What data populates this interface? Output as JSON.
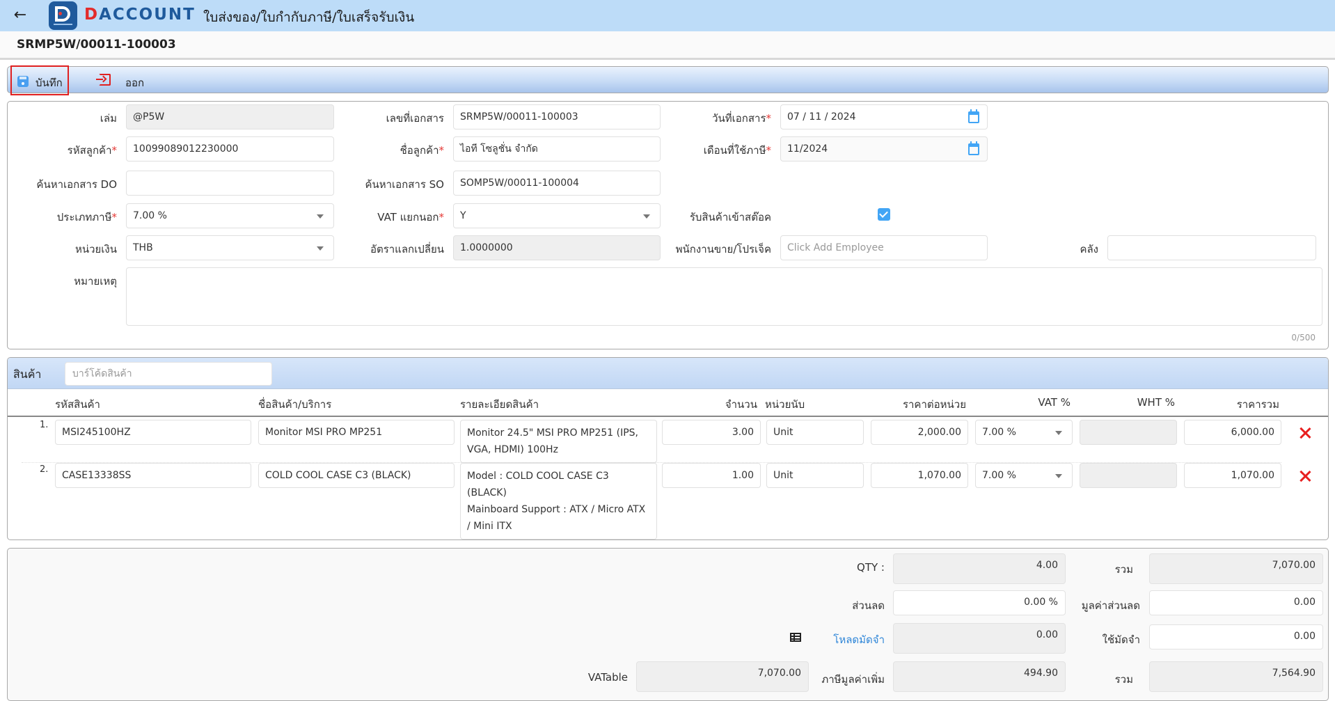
{
  "header": {
    "back_icon": "arrow-left-icon",
    "logo_first_letter": "D",
    "logo_rest": "ACCOUNT",
    "title": "ใบส่งของ/ใบกำกับภาษี/ใบเสร็จรับเงิน"
  },
  "doc_bar": {
    "doc_number": "SRMP5W/00011-100003"
  },
  "toolbar": {
    "save_label": "บันทึก",
    "save_icon": "floppy-disk-icon",
    "exit_label": "ออก",
    "exit_icon": "sign-in-icon"
  },
  "form": {
    "book": {
      "label": "เล่ม",
      "value": "@P5W"
    },
    "doc_no": {
      "label": "เลขที่เอกสาร",
      "value": "SRMP5W/00011-100003"
    },
    "doc_date": {
      "label": "วันที่เอกสาร",
      "required": "*",
      "value": "07 / 11 /  2024"
    },
    "customer_code": {
      "label": "รหัสลูกค้า",
      "required": "*",
      "value": "10099089012230000"
    },
    "customer_name": {
      "label": "ชื่อลูกค้า",
      "required": "*",
      "value": "ไอที โซลูชั่น จำกัด"
    },
    "tax_month": {
      "label": "เดือนที่ใช้ภาษี",
      "required": "*",
      "value": "11/2024"
    },
    "search_do": {
      "label": "ค้นหาเอกสาร DO",
      "value": ""
    },
    "search_so": {
      "label": "ค้นหาเอกสาร SO",
      "value": "SOMP5W/00011-100004"
    },
    "tax_type": {
      "label": "ประเภทภาษี",
      "required": "*",
      "value": "7.00 %"
    },
    "vat_separate": {
      "label": "VAT แยกนอก",
      "required": "*",
      "value": "Y"
    },
    "receive_stock": {
      "label": "รับสินค้าเข้าสต๊อค",
      "checked": true
    },
    "currency": {
      "label": "หน่วยเงิน",
      "value": "THB"
    },
    "exchange_rate": {
      "label": "อัตราแลกเปลี่ยน",
      "value": "1.0000000"
    },
    "salesperson": {
      "label": "พนักงานขาย/โปรเจ็ค",
      "placeholder": "Click Add Employee"
    },
    "warehouse": {
      "label": "คลัง",
      "value": ""
    },
    "remarks": {
      "label": "หมายเหตุ",
      "value": "",
      "counter": "0/500"
    }
  },
  "products": {
    "section_label": "สินค้า",
    "barcode_placeholder": "บาร์โค้ดสินค้า",
    "columns": [
      "รหัสสินค้า",
      "ชื่อสินค้า/บริการ",
      "รายละเอียดสินค้า",
      "จำนวน",
      "หน่วยนับ",
      "ราคาต่อหน่วย",
      "VAT %",
      "WHT %",
      "ราคารวม"
    ],
    "rows": [
      {
        "no": "1.",
        "code": "MSI245100HZ",
        "name": "Monitor MSI PRO MP251",
        "detail": "Monitor 24.5\" MSI PRO MP251 (IPS, VGA, HDMI) 100Hz",
        "qty": "3.00",
        "unit": "Unit",
        "unit_price": "2,000.00",
        "vat": "7.00 %",
        "wht": "",
        "total": "6,000.00"
      },
      {
        "no": "2.",
        "code": "CASE13338SS",
        "name": "COLD COOL CASE C3 (BLACK)",
        "detail": "Model : COLD COOL CASE C3 (BLACK)\nMainboard Support : ATX / Micro ATX / Mini ITX",
        "qty": "1.00",
        "unit": "Unit",
        "unit_price": "1,070.00",
        "vat": "7.00 %",
        "wht": "",
        "total": "1,070.00"
      }
    ]
  },
  "summary": {
    "qty_label": "QTY :",
    "qty_value": "4.00",
    "subtotal_label": "รวม",
    "subtotal_value": "7,070.00",
    "discount_label": "ส่วนลด",
    "discount_value": "0.00 %",
    "discount_amount_label": "มูลค่าส่วนลด",
    "discount_amount_value": "0.00",
    "load_deposit_label": "โหลดมัดจำ",
    "load_deposit_icon": "table-list-icon",
    "load_deposit_value": "0.00",
    "use_deposit_label": "ใช้มัดจำ",
    "use_deposit_value": "0.00",
    "vatable_label": "VATable",
    "vatable_value": "7,070.00",
    "vat_label": "ภาษีมูลค่าเพิ่ม",
    "vat_value": "494.90",
    "grand_total_label": "รวม",
    "grand_total_value": "7,564.90"
  },
  "colors": {
    "header_bg": "#bddcf8",
    "accent_blue": "#42a5f5",
    "danger_red": "#e82020",
    "link_blue": "#2f86d8"
  }
}
